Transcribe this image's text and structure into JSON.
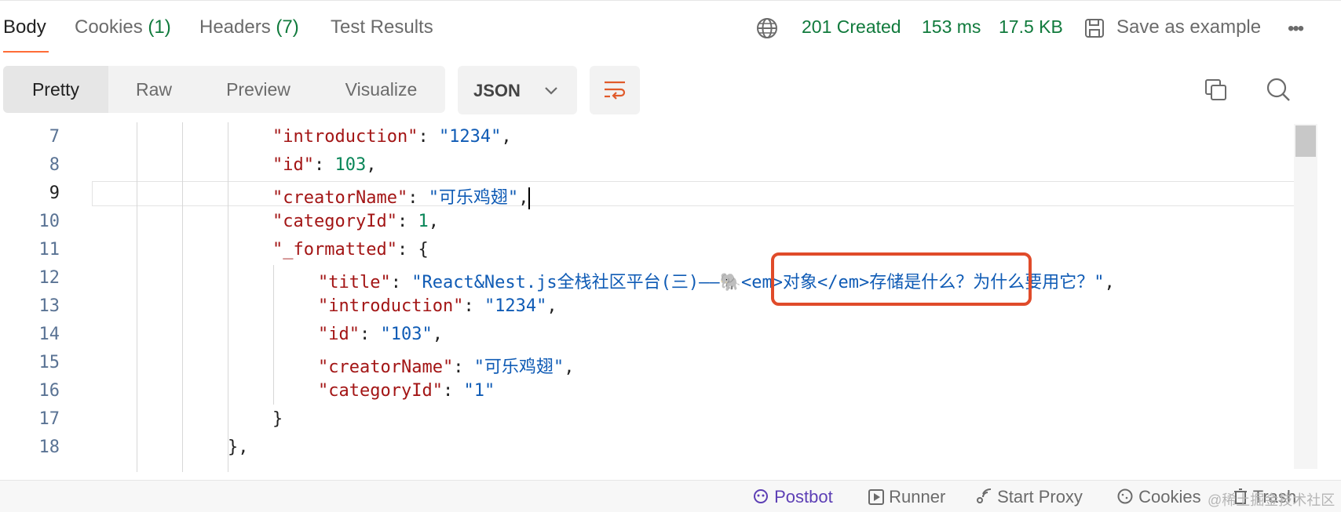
{
  "tabs": {
    "body": "Body",
    "cookies": "Cookies",
    "cookies_count": "(1)",
    "headers": "Headers",
    "headers_count": "(7)",
    "test_results": "Test Results"
  },
  "status": {
    "code": "201 Created",
    "time": "153 ms",
    "size": "17.5 KB"
  },
  "actions": {
    "save_example": "Save as example",
    "more": "•••"
  },
  "view_modes": {
    "pretty": "Pretty",
    "raw": "Raw",
    "preview": "Preview",
    "visualize": "Visualize"
  },
  "format": {
    "selected": "JSON"
  },
  "lines": {
    "7": "7",
    "8": "8",
    "9": "9",
    "10": "10",
    "11": "11",
    "12": "12",
    "13": "13",
    "14": "14",
    "15": "15",
    "16": "16",
    "17": "17",
    "18": "18"
  },
  "code": {
    "introduction_key": "\"introduction\"",
    "introduction_val": "\"1234\"",
    "id_key": "\"id\"",
    "id_val": "103",
    "creatorName_key": "\"creatorName\"",
    "creatorName_val": "\"可乐鸡翅\"",
    "categoryId_key": "\"categoryId\"",
    "categoryId_val": "1",
    "formatted_key": "\"_formatted\"",
    "f_title_key": "\"title\"",
    "f_title_val": "\"React&Nest.js全栈社区平台(三)——🐘<em>对象</em>存储是什么？为什么要用它？\"",
    "f_introduction_key": "\"introduction\"",
    "f_introduction_val": "\"1234\"",
    "f_id_key": "\"id\"",
    "f_id_val": "\"103\"",
    "f_creatorName_key": "\"creatorName\"",
    "f_creatorName_val": "\"可乐鸡翅\"",
    "f_categoryId_key": "\"categoryId\"",
    "f_categoryId_val": "\"1\"",
    "close_inner": "}",
    "close_outer": "},"
  },
  "footer": {
    "postbot": "Postbot",
    "runner": "Runner",
    "start_proxy": "Start Proxy",
    "cookies": "Cookies",
    "trash": "Trash"
  },
  "watermark": "@稀土掘金技术社区",
  "colors": {
    "accent": "#ff6c37",
    "success": "#107a3c",
    "highlight_box": "#e04b2a",
    "postbot": "#5d3fb5"
  }
}
